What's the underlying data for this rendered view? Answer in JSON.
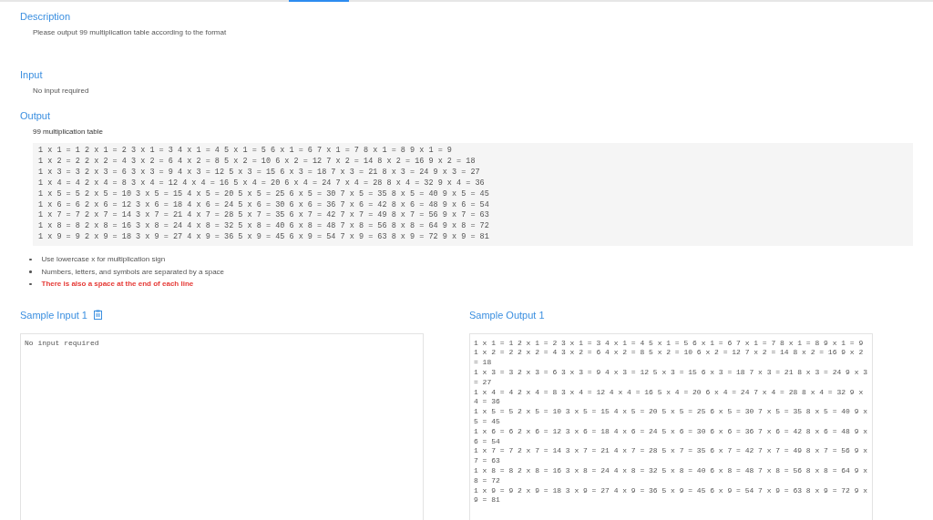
{
  "description": {
    "heading": "Description",
    "text": "Please output 99 multiplication table according to the format"
  },
  "input": {
    "heading": "Input",
    "text": "No input required"
  },
  "output": {
    "heading": "Output",
    "text": "99 multiplication table",
    "table_lines": [
      "1 x 1 = 1 2 x 1 = 2 3 x 1 = 3 4 x 1 = 4 5 x 1 = 5 6 x 1 = 6 7 x 1 = 7 8 x 1 = 8 9 x 1 = 9",
      "1 x 2 = 2 2 x 2 = 4 3 x 2 = 6 4 x 2 = 8 5 x 2 = 10 6 x 2 = 12 7 x 2 = 14 8 x 2 = 16 9 x 2 = 18",
      "1 x 3 = 3 2 x 3 = 6 3 x 3 = 9 4 x 3 = 12 5 x 3 = 15 6 x 3 = 18 7 x 3 = 21 8 x 3 = 24 9 x 3 = 27",
      "1 x 4 = 4 2 x 4 = 8 3 x 4 = 12 4 x 4 = 16 5 x 4 = 20 6 x 4 = 24 7 x 4 = 28 8 x 4 = 32 9 x 4 = 36",
      "1 x 5 = 5 2 x 5 = 10 3 x 5 = 15 4 x 5 = 20 5 x 5 = 25 6 x 5 = 30 7 x 5 = 35 8 x 5 = 40 9 x 5 = 45",
      "1 x 6 = 6 2 x 6 = 12 3 x 6 = 18 4 x 6 = 24 5 x 6 = 30 6 x 6 = 36 7 x 6 = 42 8 x 6 = 48 9 x 6 = 54",
      "1 x 7 = 7 2 x 7 = 14 3 x 7 = 21 4 x 7 = 28 5 x 7 = 35 6 x 7 = 42 7 x 7 = 49 8 x 7 = 56 9 x 7 = 63",
      "1 x 8 = 8 2 x 8 = 16 3 x 8 = 24 4 x 8 = 32 5 x 8 = 40 6 x 8 = 48 7 x 8 = 56 8 x 8 = 64 9 x 8 = 72",
      "1 x 9 = 9 2 x 9 = 18 3 x 9 = 27 4 x 9 = 36 5 x 9 = 45 6 x 9 = 54 7 x 9 = 63 8 x 9 = 72 9 x 9 = 81"
    ],
    "notes": [
      {
        "text": "Use lowercase x for multiplication sign",
        "highlighted": false
      },
      {
        "text": "Numbers, letters, and symbols are separated by a space",
        "highlighted": false
      },
      {
        "text": "There is also a space at the end of each line",
        "highlighted": true
      }
    ]
  },
  "samples": [
    {
      "heading": "Sample Input 1",
      "copy_button": true,
      "lines": [
        "No input required"
      ]
    },
    {
      "heading": "Sample Output 1",
      "copy_button": false,
      "lines": [
        "1 x 1 = 1 2 x 1 = 2 3 x 1 = 3 4 x 1 = 4 5 x 1 = 5 6 x 1 = 6 7 x 1 = 7 8 x 1 = 8 9 x 1 = 9",
        "1 x 2 = 2 2 x 2 = 4 3 x 2 = 6 4 x 2 = 8 5 x 2 = 10 6 x 2 = 12 7 x 2 = 14 8 x 2 = 16 9 x 2 = 18",
        "1 x 3 = 3 2 x 3 = 6 3 x 3 = 9 4 x 3 = 12 5 x 3 = 15 6 x 3 = 18 7 x 3 = 21 8 x 3 = 24 9 x 3 = 27",
        "1 x 4 = 4 2 x 4 = 8 3 x 4 = 12 4 x 4 = 16 5 x 4 = 20 6 x 4 = 24 7 x 4 = 28 8 x 4 = 32 9 x 4 = 36",
        "1 x 5 = 5 2 x 5 = 10 3 x 5 = 15 4 x 5 = 20 5 x 5 = 25 6 x 5 = 30 7 x 5 = 35 8 x 5 = 40 9 x 5 = 45",
        "1 x 6 = 6 2 x 6 = 12 3 x 6 = 18 4 x 6 = 24 5 x 6 = 30 6 x 6 = 36 7 x 6 = 42 8 x 6 = 48 9 x 6 = 54",
        "1 x 7 = 7 2 x 7 = 14 3 x 7 = 21 4 x 7 = 28 5 x 7 = 35 6 x 7 = 42 7 x 7 = 49 8 x 7 = 56 9 x 7 = 63",
        "1 x 8 = 8 2 x 8 = 16 3 x 8 = 24 4 x 8 = 32 5 x 8 = 40 6 x 8 = 48 7 x 8 = 56 8 x 8 = 64 9 x 8 = 72",
        "1 x 9 = 9 2 x 9 = 18 3 x 9 = 27 4 x 9 = 36 5 x 9 = 45 6 x 9 = 54 7 x 9 = 63 8 x 9 = 72 9 x 9 = 81"
      ]
    }
  ]
}
